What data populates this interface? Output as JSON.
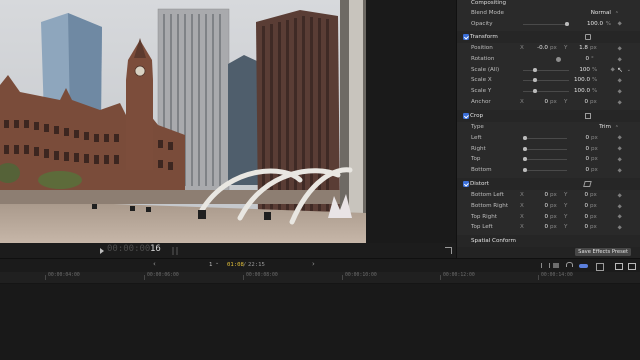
{
  "viewer": {
    "timecode_prefix": "00:00:00:",
    "timecode_frame": "16"
  },
  "inspector": {
    "compositing": {
      "title": "Compositing",
      "blend_mode_label": "Blend Mode",
      "blend_mode_value": "Normal",
      "opacity_label": "Opacity",
      "opacity_value": "100.0",
      "opacity_unit": "%",
      "opacity_level": 1.0
    },
    "transform": {
      "title": "Transform",
      "position_label": "Position",
      "position_x": "-0.0",
      "position_y": "1.8",
      "position_unit": "px",
      "rotation_label": "Rotation",
      "rotation_value": "0",
      "rotation_unit": "°",
      "scale_all_label": "Scale (All)",
      "scale_all_value": "100",
      "scale_x_label": "Scale X",
      "scale_x_value": "100.0",
      "scale_y_label": "Scale Y",
      "scale_y_value": "100.0",
      "anchor_label": "Anchor",
      "anchor_x": "0",
      "anchor_y": "0",
      "percent_unit": "%",
      "px_unit": "px"
    },
    "crop": {
      "title": "Crop",
      "type_label": "Type",
      "type_value": "Trim",
      "left_label": "Left",
      "left_value": "0",
      "right_label": "Right",
      "right_value": "0",
      "top_label": "Top",
      "top_value": "0",
      "bottom_label": "Bottom",
      "bottom_value": "0",
      "unit": "px"
    },
    "distort": {
      "title": "Distort",
      "bottom_left_label": "Bottom Left",
      "bottom_right_label": "Bottom Right",
      "top_right_label": "Top Right",
      "top_left_label": "Top Left",
      "value": "0",
      "unit": "px"
    },
    "spatial_conform_label": "Spatial Conform",
    "save_preset_label": "Save Effects Preset",
    "x_label": "X",
    "y_label": "Y"
  },
  "toolbar": {
    "index": "1",
    "current_time": "01:08",
    "separator": "/",
    "duration": "22:15"
  },
  "ruler": {
    "ticks": [
      "00:00:04:00",
      "00:00:06:00",
      "00:00:08:00",
      "00:00:10:00",
      "00:00:12:00",
      "00:00:14:00"
    ]
  },
  "colors": {
    "accent_blue": "#3b6fd8",
    "timecode_yellow": "#e4c13a"
  },
  "icons": [
    "play-icon",
    "fullscreen-icon",
    "keyframe-icon",
    "reset-icon",
    "audio-icon",
    "trim-icon"
  ]
}
